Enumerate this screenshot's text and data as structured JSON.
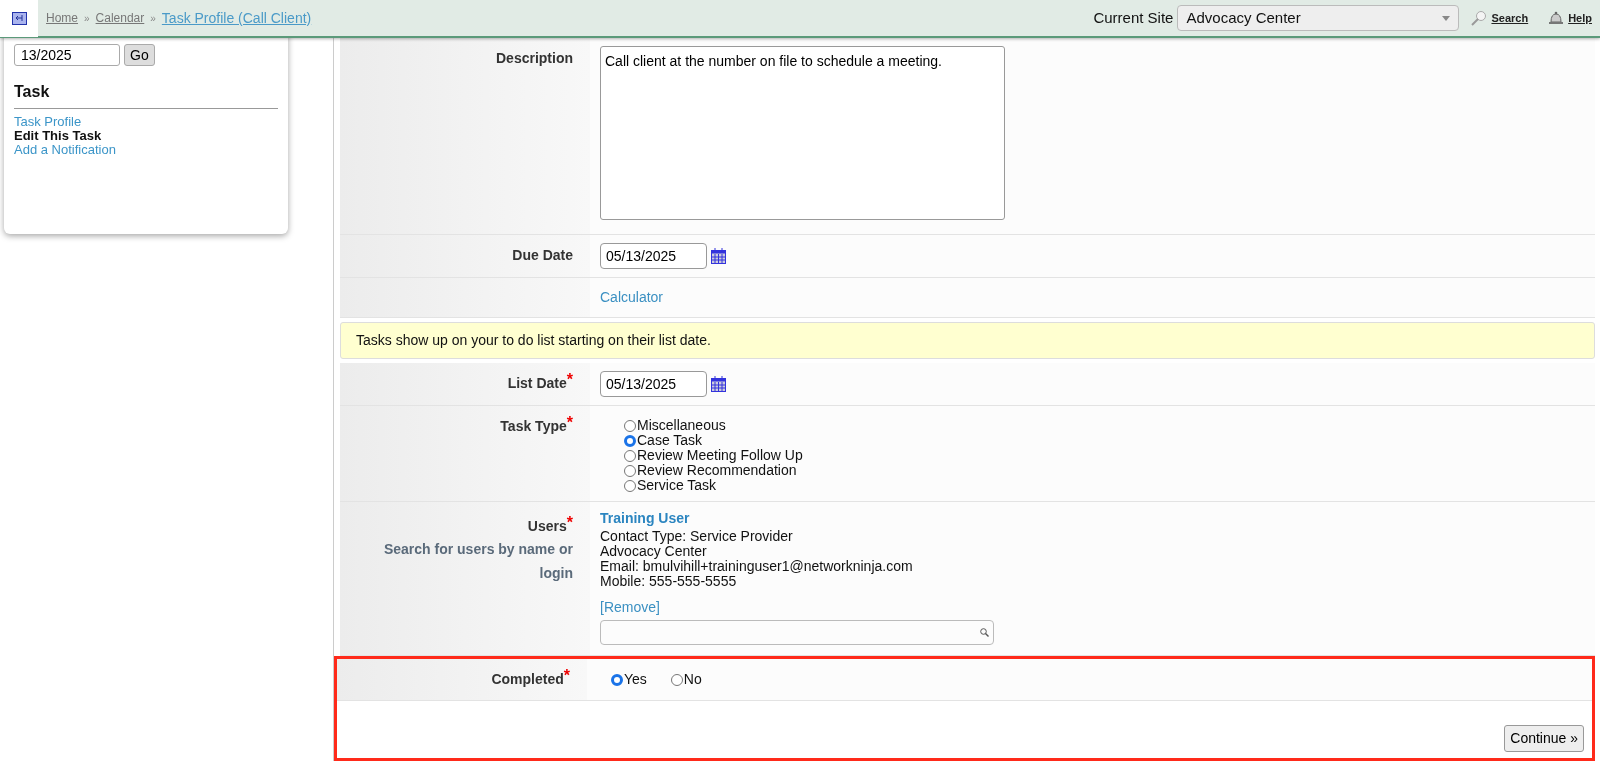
{
  "header": {
    "separator": "»",
    "breadcrumbs": [
      {
        "label": "Home",
        "current": false
      },
      {
        "label": "Calendar",
        "current": false
      },
      {
        "label": "Task Profile (Call Client)",
        "current": true
      }
    ],
    "site_label": "Current Site",
    "site_select": "Advocacy Center",
    "search": "Search",
    "help": "Help"
  },
  "sidebar": {
    "date_value": "13/2025",
    "go": "Go",
    "title": "Task",
    "links": [
      {
        "label": "Task Profile",
        "selected": false
      },
      {
        "label": "Edit This Task",
        "selected": true
      },
      {
        "label": "Add a Notification",
        "selected": false
      }
    ]
  },
  "form": {
    "rows": [
      {
        "kind": "textarea",
        "label": "Description",
        "value": "Call client at the number on file to schedule a meeting."
      },
      {
        "kind": "date",
        "label": "Due Date",
        "value": "05/13/2025"
      },
      {
        "kind": "link",
        "link": "Calculator"
      },
      {
        "kind": "notice",
        "text": "Tasks show up on your to do list starting on their list date."
      },
      {
        "kind": "date",
        "label": "List Date",
        "required_mark": "*",
        "value": "05/13/2025"
      },
      {
        "kind": "radio",
        "label": "Task Type",
        "required_mark": "*",
        "options": [
          {
            "label": "Miscellaneous",
            "selected": false
          },
          {
            "label": "Case Task",
            "selected": true
          },
          {
            "label": "Review Meeting Follow Up",
            "selected": false
          },
          {
            "label": "Review Recommendation",
            "selected": false
          },
          {
            "label": "Service Task",
            "selected": false
          }
        ]
      },
      {
        "kind": "users",
        "label": "Users",
        "required_mark": "*",
        "hint": "Search for users by name or login",
        "user": {
          "name": "Training User",
          "lines": [
            "Contact Type: Service Provider",
            "Advocacy Center",
            "Email: bmulvihill+traininguser1@networkninja.com",
            "Mobile: 555-555-5555"
          ],
          "remove": "[Remove]"
        }
      }
    ],
    "completed": {
      "label": "Completed",
      "required_mark": "*",
      "options": [
        {
          "label": "Yes",
          "selected": true
        },
        {
          "label": "No",
          "selected": false
        }
      ]
    },
    "continue": "Continue »",
    "highlighted": true
  }
}
